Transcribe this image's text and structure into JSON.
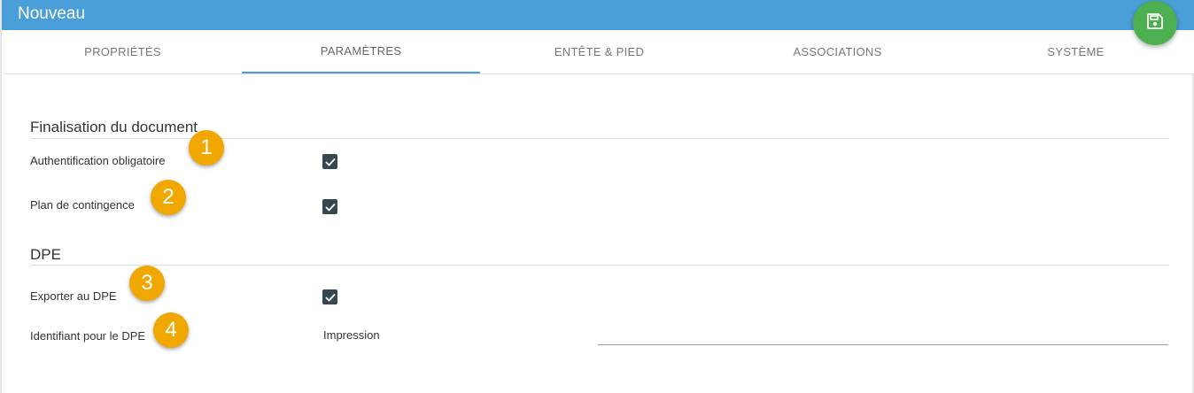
{
  "window": {
    "title": "Nouveau"
  },
  "fab": {
    "icon": "save-icon",
    "color": "#4caf50"
  },
  "tabs": [
    {
      "label": "PROPRIÉTÉS",
      "active": false
    },
    {
      "label": "PARAMÈTRES",
      "active": true
    },
    {
      "label": "ENTÊTE & PIED",
      "active": false
    },
    {
      "label": "ASSOCIATIONS",
      "active": false
    },
    {
      "label": "SYSTÈME",
      "active": false
    }
  ],
  "sections": [
    {
      "title": "Finalisation du document",
      "fields": [
        {
          "label": "Authentification obligatoire",
          "checked": true,
          "badge": "1"
        },
        {
          "label": "Plan de contingence",
          "checked": true,
          "badge": "2"
        }
      ]
    },
    {
      "title": "DPE",
      "fields": [
        {
          "label": "Exporter au DPE",
          "checked": true,
          "badge": "3"
        },
        {
          "label": "Identifiant pour le DPE",
          "value": "Impression",
          "input_value": "",
          "badge": "4"
        }
      ]
    }
  ],
  "colors": {
    "titlebar": "#4b9fd8",
    "badge": "#f0a800",
    "checkbox": "#37474f"
  }
}
